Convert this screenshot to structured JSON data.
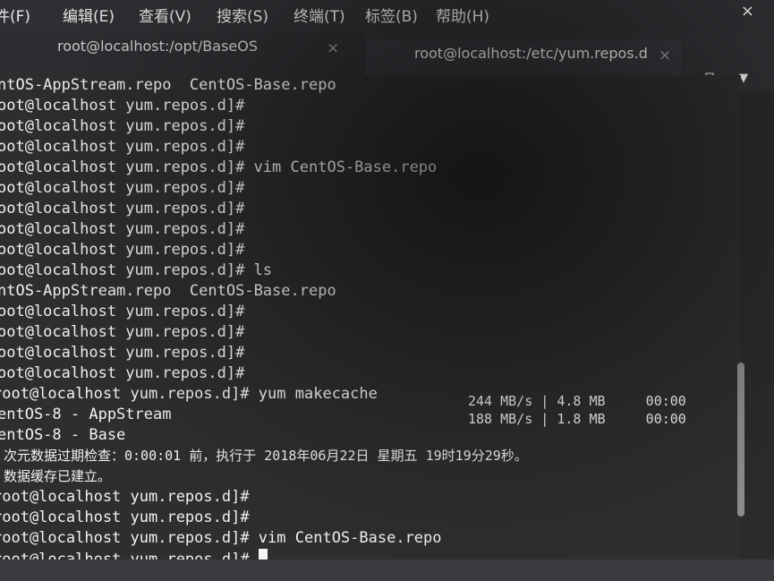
{
  "menubar": {
    "items": [
      "件(F)",
      "编辑(E)",
      "查看(V)",
      "搜索(S)",
      "终端(T)",
      "标签(B)",
      "帮助(H)"
    ],
    "close_glyph": "×"
  },
  "tabs": [
    {
      "title": "root@localhost:/opt/BaseOS",
      "close": "×"
    },
    {
      "title": "root@localhost:/etc/yum.repos.d",
      "close": "×"
    }
  ],
  "toolbar": {
    "new_tab_glyph": "⧉",
    "menu_glyph": "▼"
  },
  "terminal": {
    "lines": [
      "ntOS-AppStream.repo  CentOS-Base.repo",
      "oot@localhost yum.repos.d]#",
      "oot@localhost yum.repos.d]#",
      "oot@localhost yum.repos.d]#",
      "oot@localhost yum.repos.d]# vim CentOS-Base.repo",
      "oot@localhost yum.repos.d]#",
      "oot@localhost yum.repos.d]#",
      "oot@localhost yum.repos.d]#",
      "oot@localhost yum.repos.d]#",
      "oot@localhost yum.repos.d]# ls",
      "ntOS-AppStream.repo  CentOS-Base.repo",
      "oot@localhost yum.repos.d]#",
      "oot@localhost yum.repos.d]#",
      "oot@localhost yum.repos.d]#",
      "oot@localhost yum.repos.d]#",
      "root@localhost yum.repos.d]# yum makecache",
      "entOS-8 - AppStream",
      "entOS-8 - Base",
      "次元数据过期检查：0:00:01 前，执行于 2018年06月22日 星期五 19时19分29秒。",
      "数据缓存已建立。",
      "root@localhost yum.repos.d]#",
      "root@localhost yum.repos.d]#",
      "root@localhost yum.repos.d]# vim CentOS-Base.repo",
      "root@localhost yum.repos.d]# "
    ],
    "speeds": [
      "244 MB/s | 4.8 MB     00:00",
      "188 MB/s | 1.8 MB     00:00"
    ]
  }
}
